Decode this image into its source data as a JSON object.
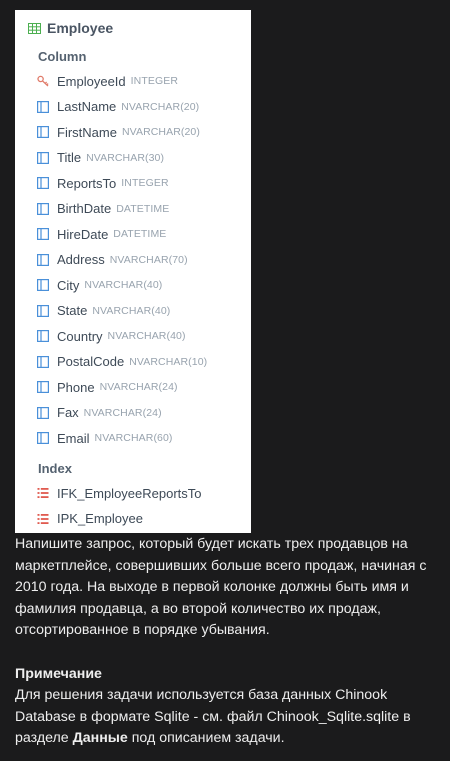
{
  "table": {
    "name": "Employee",
    "column_section": "Column",
    "index_section": "Index",
    "columns": [
      {
        "name": "EmployeeId",
        "type": "INTEGER",
        "key": true
      },
      {
        "name": "LastName",
        "type": "NVARCHAR(20)"
      },
      {
        "name": "FirstName",
        "type": "NVARCHAR(20)"
      },
      {
        "name": "Title",
        "type": "NVARCHAR(30)"
      },
      {
        "name": "ReportsTo",
        "type": "INTEGER"
      },
      {
        "name": "BirthDate",
        "type": "DATETIME"
      },
      {
        "name": "HireDate",
        "type": "DATETIME"
      },
      {
        "name": "Address",
        "type": "NVARCHAR(70)"
      },
      {
        "name": "City",
        "type": "NVARCHAR(40)"
      },
      {
        "name": "State",
        "type": "NVARCHAR(40)"
      },
      {
        "name": "Country",
        "type": "NVARCHAR(40)"
      },
      {
        "name": "PostalCode",
        "type": "NVARCHAR(10)"
      },
      {
        "name": "Phone",
        "type": "NVARCHAR(24)"
      },
      {
        "name": "Fax",
        "type": "NVARCHAR(24)"
      },
      {
        "name": "Email",
        "type": "NVARCHAR(60)"
      }
    ],
    "indexes": [
      "IFK_EmployeeReportsTo",
      "IPK_Employee"
    ]
  },
  "colors": {
    "table_icon": "#4caf50",
    "key_icon": "#e07b6a",
    "column_icon": "#4a90d9",
    "index_icon": "#e05a4f"
  },
  "task": {
    "text": "Напишите запрос, который будет искать трех продавцов на маркетплейсе, совершивших больше всего продаж, начиная с 2010 года. На выходе в первой колонке должны быть имя и фамилия продавца, а во второй количество их продаж, отсортированное в порядке убывания.",
    "note_title": "Примечание",
    "note_before": "Для решения задачи используется база данных Chinook Database в формате Sqlite - см. файл  Chinook_Sqlite.sqlite в разделе ",
    "note_bold": "Данные",
    "note_after": " под описанием задачи."
  }
}
